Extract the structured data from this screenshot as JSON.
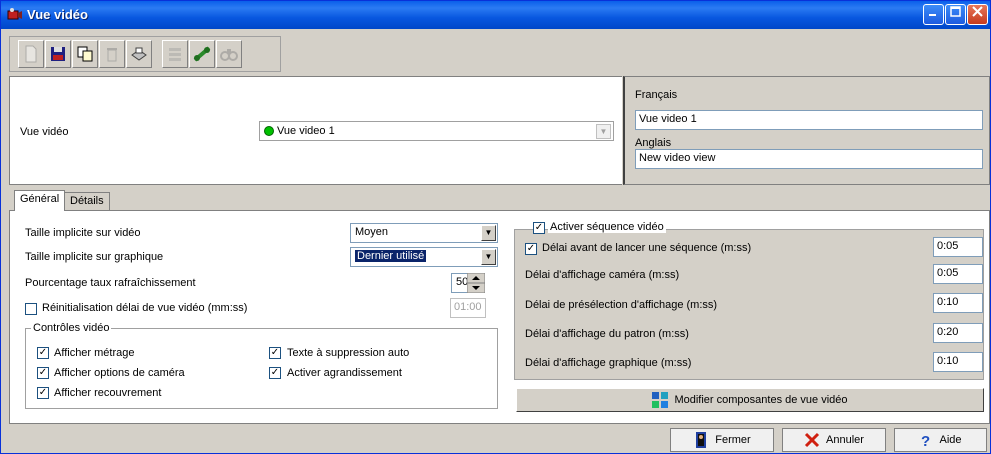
{
  "window": {
    "title": "Vue vidéo"
  },
  "toolbar": {
    "items": [
      "new-icon",
      "save-icon",
      "copy-icon",
      "delete-icon",
      "print-icon",
      "list-icon",
      "link-icon",
      "find-icon"
    ]
  },
  "header": {
    "view_label": "Vue vidéo",
    "view_value": "Vue video 1",
    "lang1_label": "Français",
    "lang1_value": "Vue video 1",
    "lang2_label": "Anglais",
    "lang2_value": "New video view"
  },
  "tabs": [
    {
      "label": "Général"
    },
    {
      "label": "Détails"
    }
  ],
  "general": {
    "size_video_label": "Taille implicite sur vidéo",
    "size_video_value": "Moyen",
    "size_graph_label": "Taille implicite sur graphique",
    "size_graph_value": "Dernier utilisé",
    "refresh_label": "Pourcentage taux rafraîchissement",
    "refresh_value": "50",
    "reset_label": "Réinitialisation délai de vue vidéo (mm:ss)",
    "reset_value": "01:00",
    "controls_title": "Contrôles vidéo",
    "controls": [
      {
        "label": "Afficher métrage"
      },
      {
        "label": "Afficher options de caméra"
      },
      {
        "label": "Afficher recouvrement"
      },
      {
        "label": "Texte à suppression auto"
      },
      {
        "label": "Activer agrandissement"
      }
    ]
  },
  "sequence": {
    "title": "Activer séquence vidéo",
    "rows": [
      {
        "label": "Délai avant de lancer une séquence (m:ss)",
        "value": "0:05"
      },
      {
        "label": "Délai d'affichage caméra (m:ss)",
        "value": "0:05"
      },
      {
        "label": "Délai de présélection d'affichage (m:ss)",
        "value": "0:10"
      },
      {
        "label": "Délai d'affichage du patron (m:ss)",
        "value": "0:20"
      },
      {
        "label": "Délai d'affichage graphique (m:ss)",
        "value": "0:10"
      }
    ],
    "modify_label": "Modifier composantes de vue vidéo"
  },
  "footer": {
    "close_label": "Fermer",
    "cancel_label": "Annuler",
    "help_label": "Aide"
  },
  "check_mark": "✓"
}
